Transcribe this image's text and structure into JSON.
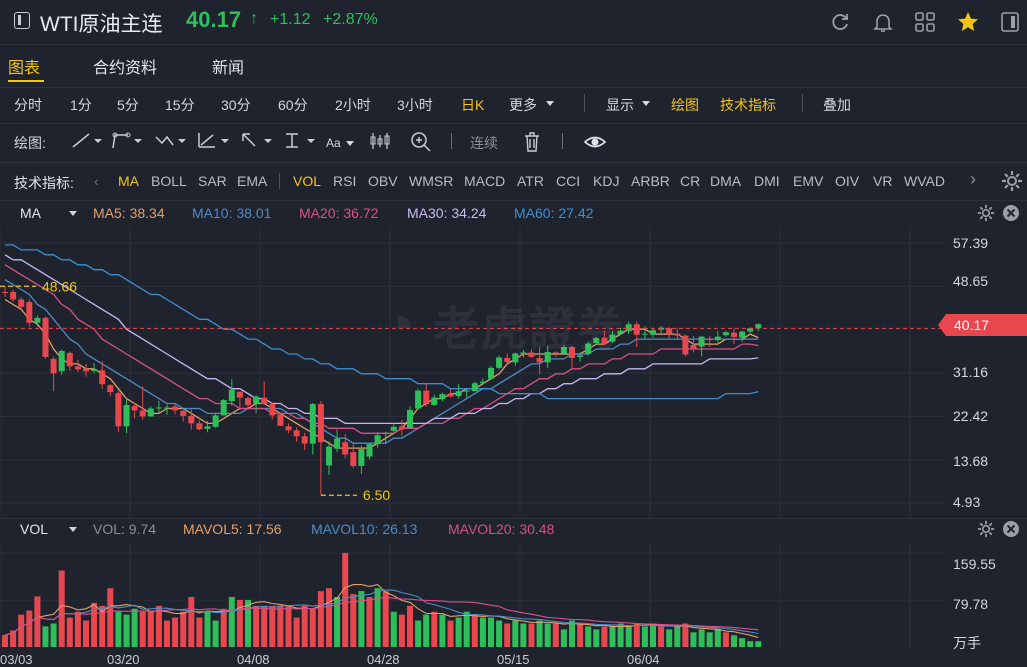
{
  "header": {
    "title": "WTI原油主连",
    "price": "40.17",
    "arrow": "↑",
    "change": "+1.12",
    "change_pct": "+2.87%",
    "icons": [
      "refresh-icon",
      "bell-icon",
      "grid-icon",
      "star-icon",
      "panel-icon"
    ]
  },
  "tabs": [
    "图表",
    "合约资料",
    "新闻"
  ],
  "periods": [
    "分时",
    "1分",
    "5分",
    "15分",
    "30分",
    "60分",
    "2小时",
    "3小时",
    "日K",
    "更多"
  ],
  "toolbar": {
    "display": "显示",
    "draw": "绘图",
    "tech": "技术指标",
    "overlay": "叠加"
  },
  "draw_tools": {
    "label": "绘图:",
    "aa": "Aa",
    "continuous": "连续"
  },
  "indicators": {
    "label": "技术指标:",
    "items": [
      "MA",
      "BOLL",
      "SAR",
      "EMA",
      "VOL",
      "RSI",
      "OBV",
      "WMSR",
      "MACD",
      "ATR",
      "CCI",
      "KDJ",
      "ARBR",
      "CR",
      "DMA",
      "DMI",
      "EMV",
      "OIV",
      "VR",
      "WVAD"
    ]
  },
  "main_legend": {
    "name": "MA",
    "items": [
      {
        "label": "MA5: 38.34",
        "color": "#e3a06a"
      },
      {
        "label": "MA10: 38.01",
        "color": "#4f8bc4"
      },
      {
        "label": "MA20: 36.72",
        "color": "#d8508a"
      },
      {
        "label": "MA30: 34.24",
        "color": "#c9b8f0"
      },
      {
        "label": "MA60: 27.42",
        "color": "#3d8fd0"
      }
    ]
  },
  "vol_legend": {
    "name": "VOL",
    "items": [
      {
        "label": "VOL: 9.74",
        "color": "#8b8f98"
      },
      {
        "label": "MAVOL5: 17.56",
        "color": "#e3a06a"
      },
      {
        "label": "MAVOL10: 26.13",
        "color": "#4f8bc4"
      },
      {
        "label": "MAVOL20: 30.48",
        "color": "#d8508a"
      }
    ]
  },
  "price_axis": [
    "57.39",
    "48.65",
    "31.16",
    "22.42",
    "13.68",
    "4.93"
  ],
  "current_price": "40.17",
  "vol_axis": [
    "159.55",
    "79.78",
    "万手"
  ],
  "annotations": {
    "high": "48.66",
    "low": "6.50"
  },
  "watermark": "老虎證券",
  "chart_data": {
    "type": "candlestick",
    "x_labels": [
      "03/03",
      "03/20",
      "04/08",
      "04/28",
      "05/15",
      "06/04"
    ],
    "ylim": [
      4.93,
      57.39
    ],
    "candles": [
      [
        47.5,
        47.4,
        48.6,
        46.5
      ],
      [
        47.5,
        46.0,
        48.0,
        45.5
      ],
      [
        46.0,
        44.5,
        46.5,
        44.0
      ],
      [
        45.5,
        41.3,
        46.0,
        40.5
      ],
      [
        41.3,
        42.3,
        42.8,
        40.6
      ],
      [
        42.3,
        34.4,
        42.5,
        34.0
      ],
      [
        34.0,
        31.1,
        34.5,
        27.5
      ],
      [
        31.5,
        35.6,
        35.9,
        30.8
      ],
      [
        35.2,
        32.5,
        35.5,
        31.6
      ],
      [
        32.5,
        31.9,
        33.8,
        31.4
      ],
      [
        32.0,
        31.5,
        33.0,
        30.4
      ],
      [
        31.6,
        31.9,
        33.2,
        31.1
      ],
      [
        31.7,
        28.9,
        33.5,
        28.0
      ],
      [
        28.7,
        27.3,
        28.9,
        26.5
      ],
      [
        27.1,
        20.4,
        27.5,
        19.2
      ],
      [
        20.4,
        24.7,
        26.0,
        19.0
      ],
      [
        24.5,
        23.6,
        25.2,
        22.0
      ],
      [
        23.6,
        22.4,
        28.5,
        21.8
      ],
      [
        22.4,
        24.0,
        24.4,
        22.3
      ],
      [
        24.0,
        24.2,
        25.5,
        23.1
      ],
      [
        24.2,
        24.2,
        24.8,
        22.7
      ],
      [
        24.4,
        23.6,
        24.9,
        22.8
      ],
      [
        23.5,
        22.5,
        24.0,
        21.3
      ],
      [
        22.5,
        21.0,
        23.8,
        19.8
      ],
      [
        21.0,
        19.8,
        21.6,
        19.6
      ],
      [
        19.9,
        20.4,
        21.5,
        19.2
      ],
      [
        20.3,
        22.6,
        23.1,
        20.1
      ],
      [
        22.6,
        25.7,
        25.9,
        22.6
      ],
      [
        25.5,
        27.8,
        29.9,
        24.6
      ],
      [
        27.4,
        26.2,
        27.3,
        24.2
      ],
      [
        26.1,
        24.7,
        26.4,
        24.1
      ],
      [
        25.0,
        26.4,
        26.7,
        23.0
      ],
      [
        26.2,
        24.9,
        29.5,
        24.8
      ],
      [
        24.9,
        22.6,
        25.2,
        21.8
      ],
      [
        22.8,
        20.5,
        22.9,
        20.4
      ],
      [
        20.4,
        19.6,
        21.0,
        19.0
      ],
      [
        19.6,
        18.4,
        20.2,
        17.3
      ],
      [
        18.4,
        16.9,
        19.1,
        15.6
      ],
      [
        16.9,
        24.9,
        25.1,
        14.7
      ],
      [
        24.9,
        17.2,
        25.5,
        6.5
      ],
      [
        12.5,
        16.3,
        17.4,
        10.6
      ],
      [
        15.9,
        17.9,
        19.8,
        15.2
      ],
      [
        17.2,
        14.7,
        18.8,
        14.0
      ],
      [
        15.2,
        12.4,
        16.9,
        12.0
      ],
      [
        12.4,
        15.8,
        16.5,
        10.8
      ],
      [
        14.3,
        16.8,
        16.9,
        13.7
      ],
      [
        16.8,
        18.6,
        19.2,
        16.1
      ],
      [
        18.9,
        19.1,
        19.3,
        16.8
      ],
      [
        19.5,
        20.3,
        21.0,
        19.2
      ],
      [
        20.4,
        19.8,
        21.7,
        18.4
      ],
      [
        20.1,
        23.7,
        24.4,
        20.0
      ],
      [
        24.0,
        27.6,
        28.0,
        23.8
      ],
      [
        27.6,
        24.9,
        29.0,
        24.4
      ],
      [
        24.7,
        26.2,
        26.8,
        24.5
      ],
      [
        25.9,
        26.9,
        27.2,
        25.4
      ],
      [
        27.0,
        26.4,
        27.9,
        26.3
      ],
      [
        26.5,
        27.5,
        28.9,
        26.0
      ],
      [
        27.5,
        27.6,
        27.9,
        26.2
      ],
      [
        27.5,
        29.1,
        29.4,
        27.5
      ],
      [
        29.1,
        29.4,
        30.1,
        28.8
      ],
      [
        30.0,
        32.2,
        32.6,
        29.8
      ],
      [
        32.2,
        34.3,
        34.7,
        31.9
      ],
      [
        34.2,
        33.4,
        35.1,
        33.1
      ],
      [
        33.3,
        35.1,
        35.3,
        32.6
      ],
      [
        35.0,
        35.3,
        35.8,
        34.3
      ],
      [
        35.3,
        34.4,
        35.9,
        34.2
      ],
      [
        34.2,
        33.3,
        36.4,
        30.9
      ],
      [
        33.3,
        35.4,
        36.6,
        32.2
      ],
      [
        35.3,
        35.1,
        35.5,
        34.4
      ],
      [
        35.1,
        36.4,
        36.8,
        35.1
      ],
      [
        36.4,
        34.2,
        36.6,
        31.9
      ],
      [
        34.4,
        34.7,
        35.3,
        33.4
      ],
      [
        35.0,
        37.1,
        37.5,
        34.7
      ],
      [
        37.2,
        38.2,
        38.4,
        36.9
      ],
      [
        38.3,
        37.0,
        39.7,
        36.8
      ],
      [
        37.5,
        38.9,
        39.6,
        37.2
      ],
      [
        39.0,
        39.7,
        40.3,
        38.9
      ],
      [
        39.6,
        41.0,
        41.5,
        39.0
      ],
      [
        41.0,
        38.9,
        41.6,
        36.4
      ],
      [
        38.9,
        39.1,
        40.6,
        38.0
      ],
      [
        38.9,
        39.8,
        40.3,
        38.3
      ],
      [
        39.9,
        40.3,
        40.7,
        39.1
      ],
      [
        40.2,
        39.2,
        40.4,
        38.1
      ],
      [
        39.1,
        38.7,
        40.2,
        37.9
      ],
      [
        38.7,
        34.9,
        38.9,
        34.5
      ],
      [
        36.8,
        36.1,
        38.6,
        35.3
      ],
      [
        36.5,
        38.5,
        38.6,
        34.5
      ],
      [
        38.1,
        37.8,
        38.6,
        36.4
      ],
      [
        37.8,
        38.5,
        39.6,
        37.3
      ],
      [
        38.8,
        39.4,
        39.7,
        38.5
      ],
      [
        39.3,
        38.4,
        40.2,
        37.0
      ],
      [
        38.3,
        39.5,
        39.7,
        37.5
      ],
      [
        39.5,
        40.2,
        40.4,
        39.3
      ],
      [
        40.2,
        41.0,
        41.2,
        39.6
      ]
    ],
    "ma_lines": [
      {
        "name": "MA5",
        "color": "#e3a06a",
        "values": [
          46,
          45,
          44,
          42,
          41,
          39,
          36,
          34,
          33,
          33,
          32,
          32,
          31,
          30,
          28,
          26,
          25,
          24,
          23,
          23,
          24,
          24,
          24,
          23,
          22,
          21,
          21,
          22,
          23,
          24,
          24,
          25,
          25,
          24,
          23,
          22,
          21,
          20,
          19,
          18,
          17,
          16,
          16,
          16,
          16,
          16,
          17,
          18,
          19,
          20,
          22,
          24,
          25,
          26,
          26,
          27,
          27,
          28,
          28,
          29,
          30,
          31,
          33,
          34,
          35,
          35,
          35,
          35,
          35,
          35,
          35,
          35,
          36,
          37,
          37,
          38,
          39,
          40,
          40,
          40,
          39,
          39,
          39,
          39,
          38,
          37,
          37,
          37,
          37,
          38,
          38,
          38,
          39,
          38.3
        ]
      },
      {
        "name": "MA10",
        "color": "#4f8bc4",
        "values": [
          50,
          49,
          48,
          47,
          45,
          44,
          42,
          40,
          38,
          37,
          35,
          34,
          33,
          32,
          31,
          30,
          29,
          28,
          27,
          26,
          25,
          25,
          24,
          24,
          24,
          23,
          23,
          23,
          23,
          23,
          24,
          24,
          24,
          24,
          24,
          23,
          23,
          22,
          21,
          20,
          19,
          18,
          18,
          17,
          17,
          17,
          17,
          17,
          18,
          18,
          19,
          20,
          21,
          22,
          23,
          24,
          25,
          26,
          27,
          28,
          28,
          29,
          30,
          31,
          32,
          33,
          33,
          34,
          34,
          34,
          35,
          35,
          35,
          36,
          36,
          36,
          37,
          37,
          38,
          38,
          38,
          38,
          38,
          38,
          38,
          38,
          38,
          38,
          38,
          38,
          38,
          38,
          38,
          38.0
        ]
      },
      {
        "name": "MA20",
        "color": "#d8508a",
        "values": [
          53,
          52,
          51,
          50,
          49,
          48,
          47,
          45,
          44,
          42,
          41,
          40,
          38,
          37,
          36,
          35,
          34,
          33,
          32,
          31,
          30,
          29,
          28,
          27,
          26,
          26,
          25,
          25,
          25,
          24,
          24,
          24,
          24,
          23,
          23,
          23,
          22,
          22,
          21,
          21,
          20,
          20,
          20,
          20,
          19,
          19,
          19,
          19,
          19,
          20,
          20,
          20,
          21,
          21,
          21,
          22,
          22,
          23,
          24,
          24,
          25,
          26,
          27,
          28,
          28,
          29,
          30,
          30,
          31,
          31,
          32,
          32,
          33,
          33,
          33,
          34,
          34,
          35,
          35,
          35,
          35,
          36,
          36,
          36,
          36,
          36,
          36,
          36,
          36,
          36,
          36,
          37,
          37,
          36.7
        ]
      },
      {
        "name": "MA30",
        "color": "#c9b8f0",
        "values": [
          55,
          54,
          54,
          53,
          52,
          51,
          50,
          49,
          48,
          47,
          46,
          45,
          44,
          43,
          42,
          40,
          39,
          38,
          37,
          36,
          35,
          34,
          33,
          32,
          31,
          30,
          30,
          29,
          28,
          28,
          27,
          26,
          26,
          25,
          25,
          24,
          24,
          23,
          23,
          22,
          22,
          22,
          21,
          21,
          21,
          21,
          21,
          21,
          21,
          21,
          21,
          21,
          21,
          22,
          22,
          22,
          23,
          23,
          23,
          24,
          24,
          25,
          25,
          26,
          26,
          27,
          27,
          28,
          28,
          29,
          29,
          30,
          30,
          30,
          31,
          31,
          31,
          32,
          32,
          32,
          33,
          33,
          33,
          33,
          33,
          33,
          33,
          34,
          34,
          34,
          34,
          34,
          34,
          34.2
        ]
      },
      {
        "name": "MA60",
        "color": "#3d8fd0",
        "values": [
          57,
          57,
          56,
          56,
          56,
          55,
          55,
          54,
          54,
          53,
          53,
          52,
          52,
          51,
          51,
          50,
          49,
          48,
          47,
          47,
          46,
          45,
          44,
          43,
          42,
          42,
          41,
          40,
          40,
          39,
          38,
          38,
          37,
          36,
          36,
          35,
          35,
          34,
          34,
          33,
          33,
          32,
          32,
          32,
          31,
          31,
          31,
          30,
          30,
          30,
          30,
          29,
          29,
          29,
          29,
          28,
          28,
          28,
          28,
          28,
          28,
          27,
          27,
          27,
          27,
          27,
          27,
          26,
          26,
          26,
          26,
          26,
          26,
          26,
          26,
          26,
          26,
          26,
          26,
          26,
          26,
          26,
          26,
          26,
          26,
          26,
          26,
          26,
          26,
          27,
          27,
          27,
          27,
          27.4
        ]
      }
    ],
    "volumes": [
      [
        20,
        1
      ],
      [
        28,
        1
      ],
      [
        55,
        1
      ],
      [
        62,
        1
      ],
      [
        86,
        1
      ],
      [
        35,
        0
      ],
      [
        40,
        0
      ],
      [
        130,
        1
      ],
      [
        50,
        1
      ],
      [
        60,
        1
      ],
      [
        45,
        1
      ],
      [
        75,
        1
      ],
      [
        70,
        1
      ],
      [
        100,
        1
      ],
      [
        60,
        0
      ],
      [
        55,
        0
      ],
      [
        65,
        0
      ],
      [
        60,
        1
      ],
      [
        60,
        1
      ],
      [
        70,
        1
      ],
      [
        45,
        1
      ],
      [
        50,
        1
      ],
      [
        60,
        1
      ],
      [
        85,
        1
      ],
      [
        50,
        1
      ],
      [
        60,
        0
      ],
      [
        45,
        0
      ],
      [
        65,
        1
      ],
      [
        85,
        0
      ],
      [
        80,
        1
      ],
      [
        80,
        0
      ],
      [
        70,
        1
      ],
      [
        70,
        1
      ],
      [
        70,
        1
      ],
      [
        70,
        1
      ],
      [
        70,
        1
      ],
      [
        50,
        1
      ],
      [
        70,
        1
      ],
      [
        65,
        1
      ],
      [
        95,
        1
      ],
      [
        100,
        1
      ],
      [
        85,
        0
      ],
      [
        160,
        1
      ],
      [
        90,
        1
      ],
      [
        95,
        0
      ],
      [
        85,
        1
      ],
      [
        100,
        0
      ],
      [
        95,
        1
      ],
      [
        60,
        0
      ],
      [
        55,
        1
      ],
      [
        70,
        1
      ],
      [
        45,
        0
      ],
      [
        55,
        0
      ],
      [
        60,
        1
      ],
      [
        55,
        0
      ],
      [
        45,
        1
      ],
      [
        50,
        0
      ],
      [
        60,
        0
      ],
      [
        55,
        1
      ],
      [
        50,
        0
      ],
      [
        50,
        0
      ],
      [
        45,
        0
      ],
      [
        40,
        1
      ],
      [
        45,
        0
      ],
      [
        40,
        0
      ],
      [
        40,
        1
      ],
      [
        45,
        0
      ],
      [
        40,
        0
      ],
      [
        40,
        1
      ],
      [
        30,
        0
      ],
      [
        45,
        0
      ],
      [
        40,
        1
      ],
      [
        35,
        0
      ],
      [
        30,
        0
      ],
      [
        35,
        1
      ],
      [
        35,
        0
      ],
      [
        40,
        0
      ],
      [
        35,
        0
      ],
      [
        40,
        1
      ],
      [
        35,
        0
      ],
      [
        40,
        0
      ],
      [
        35,
        1
      ],
      [
        30,
        0
      ],
      [
        35,
        0
      ],
      [
        40,
        1
      ],
      [
        25,
        0
      ],
      [
        30,
        0
      ],
      [
        25,
        0
      ],
      [
        30,
        0
      ],
      [
        25,
        1
      ],
      [
        20,
        0
      ],
      [
        15,
        0
      ],
      [
        10,
        0
      ],
      [
        9.74,
        0
      ]
    ]
  }
}
